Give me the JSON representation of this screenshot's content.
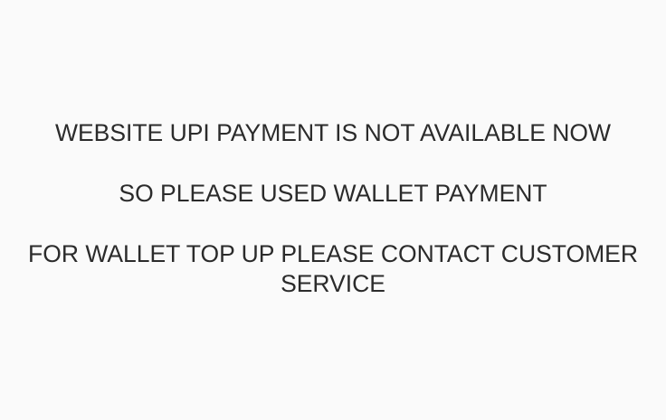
{
  "messages": {
    "line1": "WEBSITE UPI PAYMENT IS NOT AVAILABLE NOW",
    "line2": "SO PLEASE USED WALLET PAYMENT",
    "line3a": "FOR WALLET TOP UP PLEASE CONTACT CUSTOMER",
    "line3b": "SERVICE"
  },
  "colors": {
    "background": "#fafafa",
    "text": "#2b2b2b"
  }
}
